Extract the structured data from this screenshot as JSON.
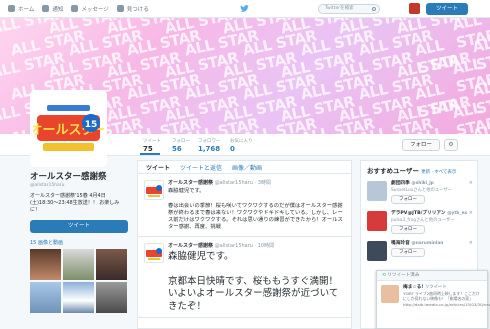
{
  "topbar": {
    "home": "ホーム",
    "notifications": "通知",
    "messages": "メッセージ",
    "discover": "見つける",
    "search_placeholder": "Twitterを検索",
    "tweet_button": "ツイート"
  },
  "banner": {
    "word": "ALL STAR"
  },
  "profile": {
    "name": "オールスター感謝祭",
    "handle": "@allstar15haru",
    "bio": "オールスター感謝祭'15春 4月4日(土)18:30〜23:48生放送！！ お楽しみに！",
    "tweet_button": "ツイート",
    "photos_label": "15 画像と動画",
    "avatar_text": "オールスター感謝祭'15"
  },
  "stats": [
    {
      "label": "ツイート",
      "value": "75"
    },
    {
      "label": "フォロー",
      "value": "56"
    },
    {
      "label": "フォロワー",
      "value": "1,768"
    },
    {
      "label": "お気に入り",
      "value": "0"
    }
  ],
  "actions": {
    "follow": "フォロー",
    "gear": "⚙"
  },
  "timeline": {
    "tabs": [
      "ツイート",
      "ツイートと返信",
      "画像／動画"
    ],
    "tweets": [
      {
        "name": "オールスター感謝祭",
        "meta": "@allstar15haru · 3時間",
        "text": "森脇健児です。\n\n春は出会いの季節！桜も咲いてワクワクするのだが僕はオールスター感謝祭が終わるまで春は来ない！ワクワクやドキドキしている。しかし、レース前だけはワクワクする。それは思い通りの練習ができたから！オールスター感謝、再度、挑戦"
      },
      {
        "name": "オールスター感謝祭",
        "meta": "@allstar15haru · 10時間",
        "text": "森脇健児です。\n\n京都本日快晴です、桜ももうすぐ満開！いよいよオールスター感謝祭が近づいてきたぞ！"
      }
    ]
  },
  "suggestions": {
    "header": "おすすめユーザー",
    "refresh": "更新 · すべて表示",
    "items": [
      {
        "name": "劇団四季",
        "handle": "@shiki_jp",
        "sub": "SunsetLuxさんと他のユーザー",
        "follow": "フォロー",
        "color": "#b7c7d8"
      },
      {
        "name": "デラPV@JTB/ブリリアン",
        "handle": "@ytb_ex",
        "sub": "pulsa3_frogさんと他のユーザー",
        "follow": "フォロー",
        "color": "#d63a3a"
      },
      {
        "name": "鳴海玲音",
        "handle": "@naruminlan",
        "sub": "",
        "follow": "フォロー",
        "color": "#3d4a5a"
      }
    ]
  },
  "popup": {
    "header": "リツイート済み",
    "name": "梅ま☆る!",
    "action": "リツイート",
    "text": "YSIRT ライブ2曲同時上映します！ここだけにしか見れない映像も！「劇場名の家」 http://daib.lmedia.co.jp/articles/15/03/30/news153.html"
  }
}
